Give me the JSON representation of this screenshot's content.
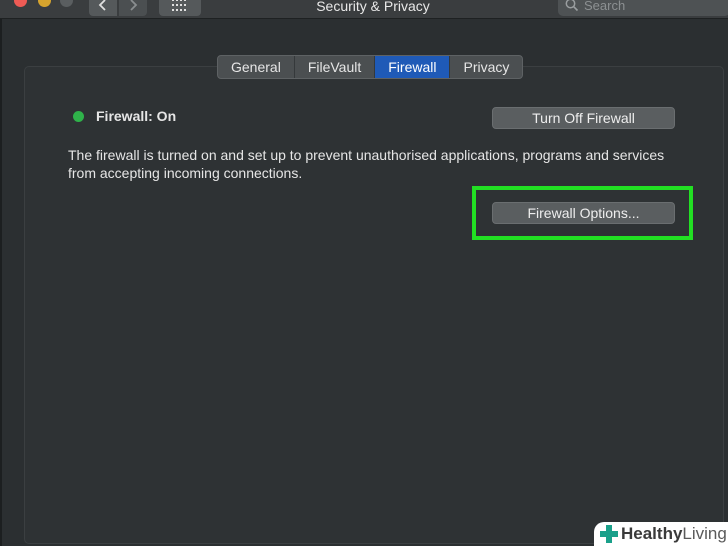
{
  "window": {
    "title": "Security & Privacy"
  },
  "search": {
    "placeholder": "Search"
  },
  "tabs": [
    {
      "label": "General",
      "active": false
    },
    {
      "label": "FileVault",
      "active": false
    },
    {
      "label": "Firewall",
      "active": true
    },
    {
      "label": "Privacy",
      "active": false
    }
  ],
  "firewall": {
    "status_label": "Firewall: On",
    "status_color": "#2fb24a",
    "turn_off_label": "Turn Off Firewall",
    "description": "The firewall is turned on and set up to prevent unauthorised applications, programs and services from accepting incoming connections.",
    "options_label": "Firewall Options..."
  },
  "watermark": {
    "bold": "Healthy",
    "light": "Living"
  },
  "colors": {
    "accent": "#1f5ab7",
    "highlight": "#22e023",
    "close": "#ee5b55",
    "minimize": "#d6a42e"
  }
}
